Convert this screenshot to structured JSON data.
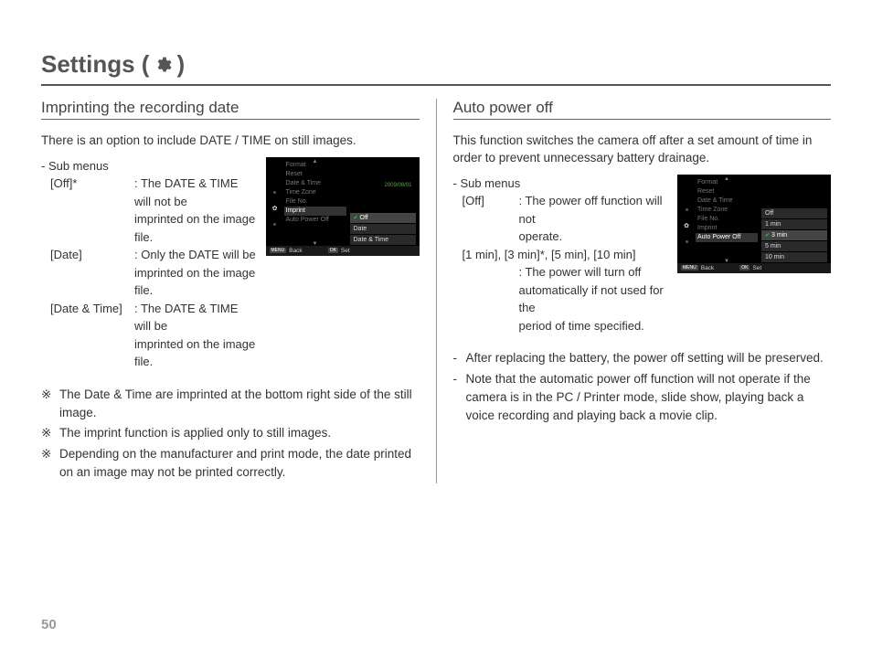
{
  "page_number": "50",
  "title_prefix": "Settings (",
  "title_suffix": ")",
  "left": {
    "heading": "Imprinting the recording date",
    "intro": "There is an option to include DATE / TIME on still images.",
    "submenu_label": "- Sub menus",
    "rows": [
      {
        "key": "[Off]*",
        "desc1": ": The DATE & TIME will not be",
        "desc2": "imprinted on the image file."
      },
      {
        "key": "[Date]",
        "desc1": ": Only the DATE will be",
        "desc2": "imprinted on the image file."
      },
      {
        "key": "[Date & Time]",
        "desc1": ": The DATE & TIME will be",
        "desc2": "imprinted on the image file."
      }
    ],
    "notes": [
      "The Date & Time are imprinted at the bottom right side of the still image.",
      "The imprint function is applied only to still images.",
      "Depending on the manufacturer and print mode, the date printed on an image may not be printed correctly."
    ],
    "cam": {
      "menu": [
        "Format",
        "Reset",
        "Date & Time",
        "Time Zone",
        "File No.",
        "Imprint",
        "Auto Power Off"
      ],
      "active": "Imprint",
      "date_hint": "2009/08/01",
      "options": [
        "Off",
        "Date",
        "Date & Time"
      ],
      "selected": "Off",
      "footer_back_btn": "MENU",
      "footer_back": "Back",
      "footer_set_btn": "OK",
      "footer_set": "Set"
    }
  },
  "right": {
    "heading": "Auto power off",
    "intro": "This function switches the camera off after a set amount of time in order to prevent unnecessary battery drainage.",
    "submenu_label": "- Sub menus",
    "row_off_key": "[Off]",
    "row_off_desc1": ": The power off function will not",
    "row_off_desc2": "operate.",
    "row_list": "[1 min], [3 min]*, [5 min], [10 min]",
    "row_list_desc1": ": The power will turn off",
    "row_list_desc2": "automatically if not used for the",
    "row_list_desc3": "period of time specified.",
    "notes": [
      "After replacing the battery, the power off setting will be preserved.",
      "Note that the automatic power off function will not operate if the camera is in the PC / Printer mode, slide show, playing back a voice recording and playing back a movie clip."
    ],
    "cam": {
      "menu": [
        "Format",
        "Reset",
        "Date & Time",
        "Time Zone",
        "File No.",
        "Imprint",
        "Auto Power Off"
      ],
      "active": "Auto Power Off",
      "options": [
        "Off",
        "1 min",
        "3 min",
        "5 min",
        "10 min"
      ],
      "selected": "3 min",
      "footer_back_btn": "MENU",
      "footer_back": "Back",
      "footer_set_btn": "OK",
      "footer_set": "Set"
    }
  }
}
